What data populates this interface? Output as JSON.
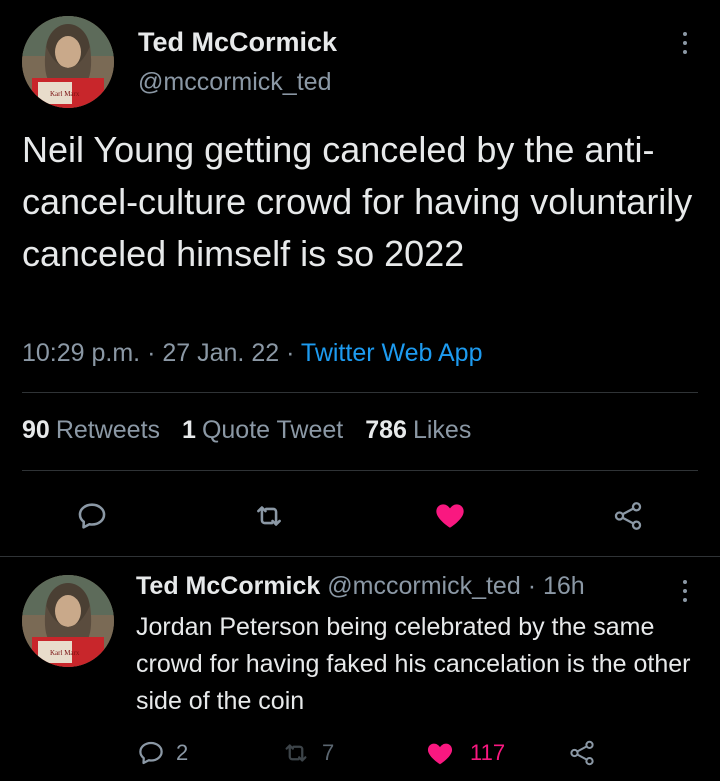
{
  "main_tweet": {
    "author_name": "Ted McCormick",
    "author_handle": "@mccormick_ted",
    "avatar_book_text": "Karl Marx",
    "text": "Neil Young getting canceled by the anti-cancel-culture crowd for having voluntarily canceled himself is so 2022",
    "time": "10:29 p.m.",
    "separator": "·",
    "date": "27 Jan. 22",
    "source_app": "Twitter Web App",
    "stats": {
      "retweets_count": "90",
      "retweets_label": "Retweets",
      "quotes_count": "1",
      "quotes_label": "Quote Tweet",
      "likes_count": "786",
      "likes_label": "Likes"
    },
    "liked": true
  },
  "reply": {
    "author_name": "Ted McCormick",
    "author_handle": "@mccormick_ted",
    "separator": "·",
    "time": "16h",
    "avatar_book_text": "Karl Marx",
    "text": "Jordan Peterson being celebrated by the same crowd for having faked his cancelation is the other side of the coin",
    "reply_count": "2",
    "retweet_count": "7",
    "like_count": "117",
    "liked": true
  },
  "icons": [
    "reply-icon",
    "retweet-icon",
    "like-icon",
    "share-icon",
    "more-icon"
  ],
  "colors": {
    "background": "#000000",
    "text": "#e7e9ea",
    "secondary": "#8b98a5",
    "link": "#1d9bf0",
    "like": "#f91880",
    "divider": "#2f3336"
  }
}
